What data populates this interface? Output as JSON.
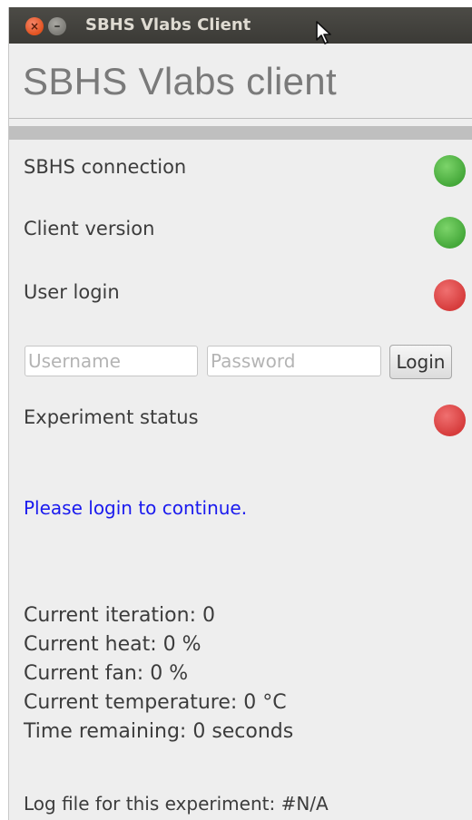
{
  "window": {
    "title": "SBHS Vlabs Client",
    "close_glyph": "×",
    "minimize_glyph": "–"
  },
  "header": {
    "title": "SBHS Vlabs client"
  },
  "status_rows": [
    {
      "label": "SBHS connection",
      "state": "green",
      "color": "#4caf45"
    },
    {
      "label": "Client version",
      "state": "green",
      "color": "#4caf45"
    },
    {
      "label": "User login",
      "state": "red",
      "color": "#da4040"
    }
  ],
  "login": {
    "username_placeholder": "Username",
    "username_value": "",
    "password_placeholder": "Password",
    "password_value": "",
    "button_label": "Login"
  },
  "experiment": {
    "label": "Experiment status",
    "state": "red",
    "color": "#da4040"
  },
  "notice": {
    "text": "Please login to continue.",
    "color": "#1a1aee"
  },
  "stats": {
    "iteration": "Current iteration: 0",
    "heat": "Current heat: 0 %",
    "fan": "Current fan: 0 %",
    "temperature": "Current temperature: 0 °C",
    "time_remaining": "Time remaining: 0 seconds"
  },
  "log": {
    "text": "Log file for this experiment: #N/A"
  },
  "icons": {
    "close": "close-icon",
    "minimize": "minimize-icon",
    "cursor": "mouse-cursor-icon",
    "status_indicator": "status-dot-icon"
  }
}
